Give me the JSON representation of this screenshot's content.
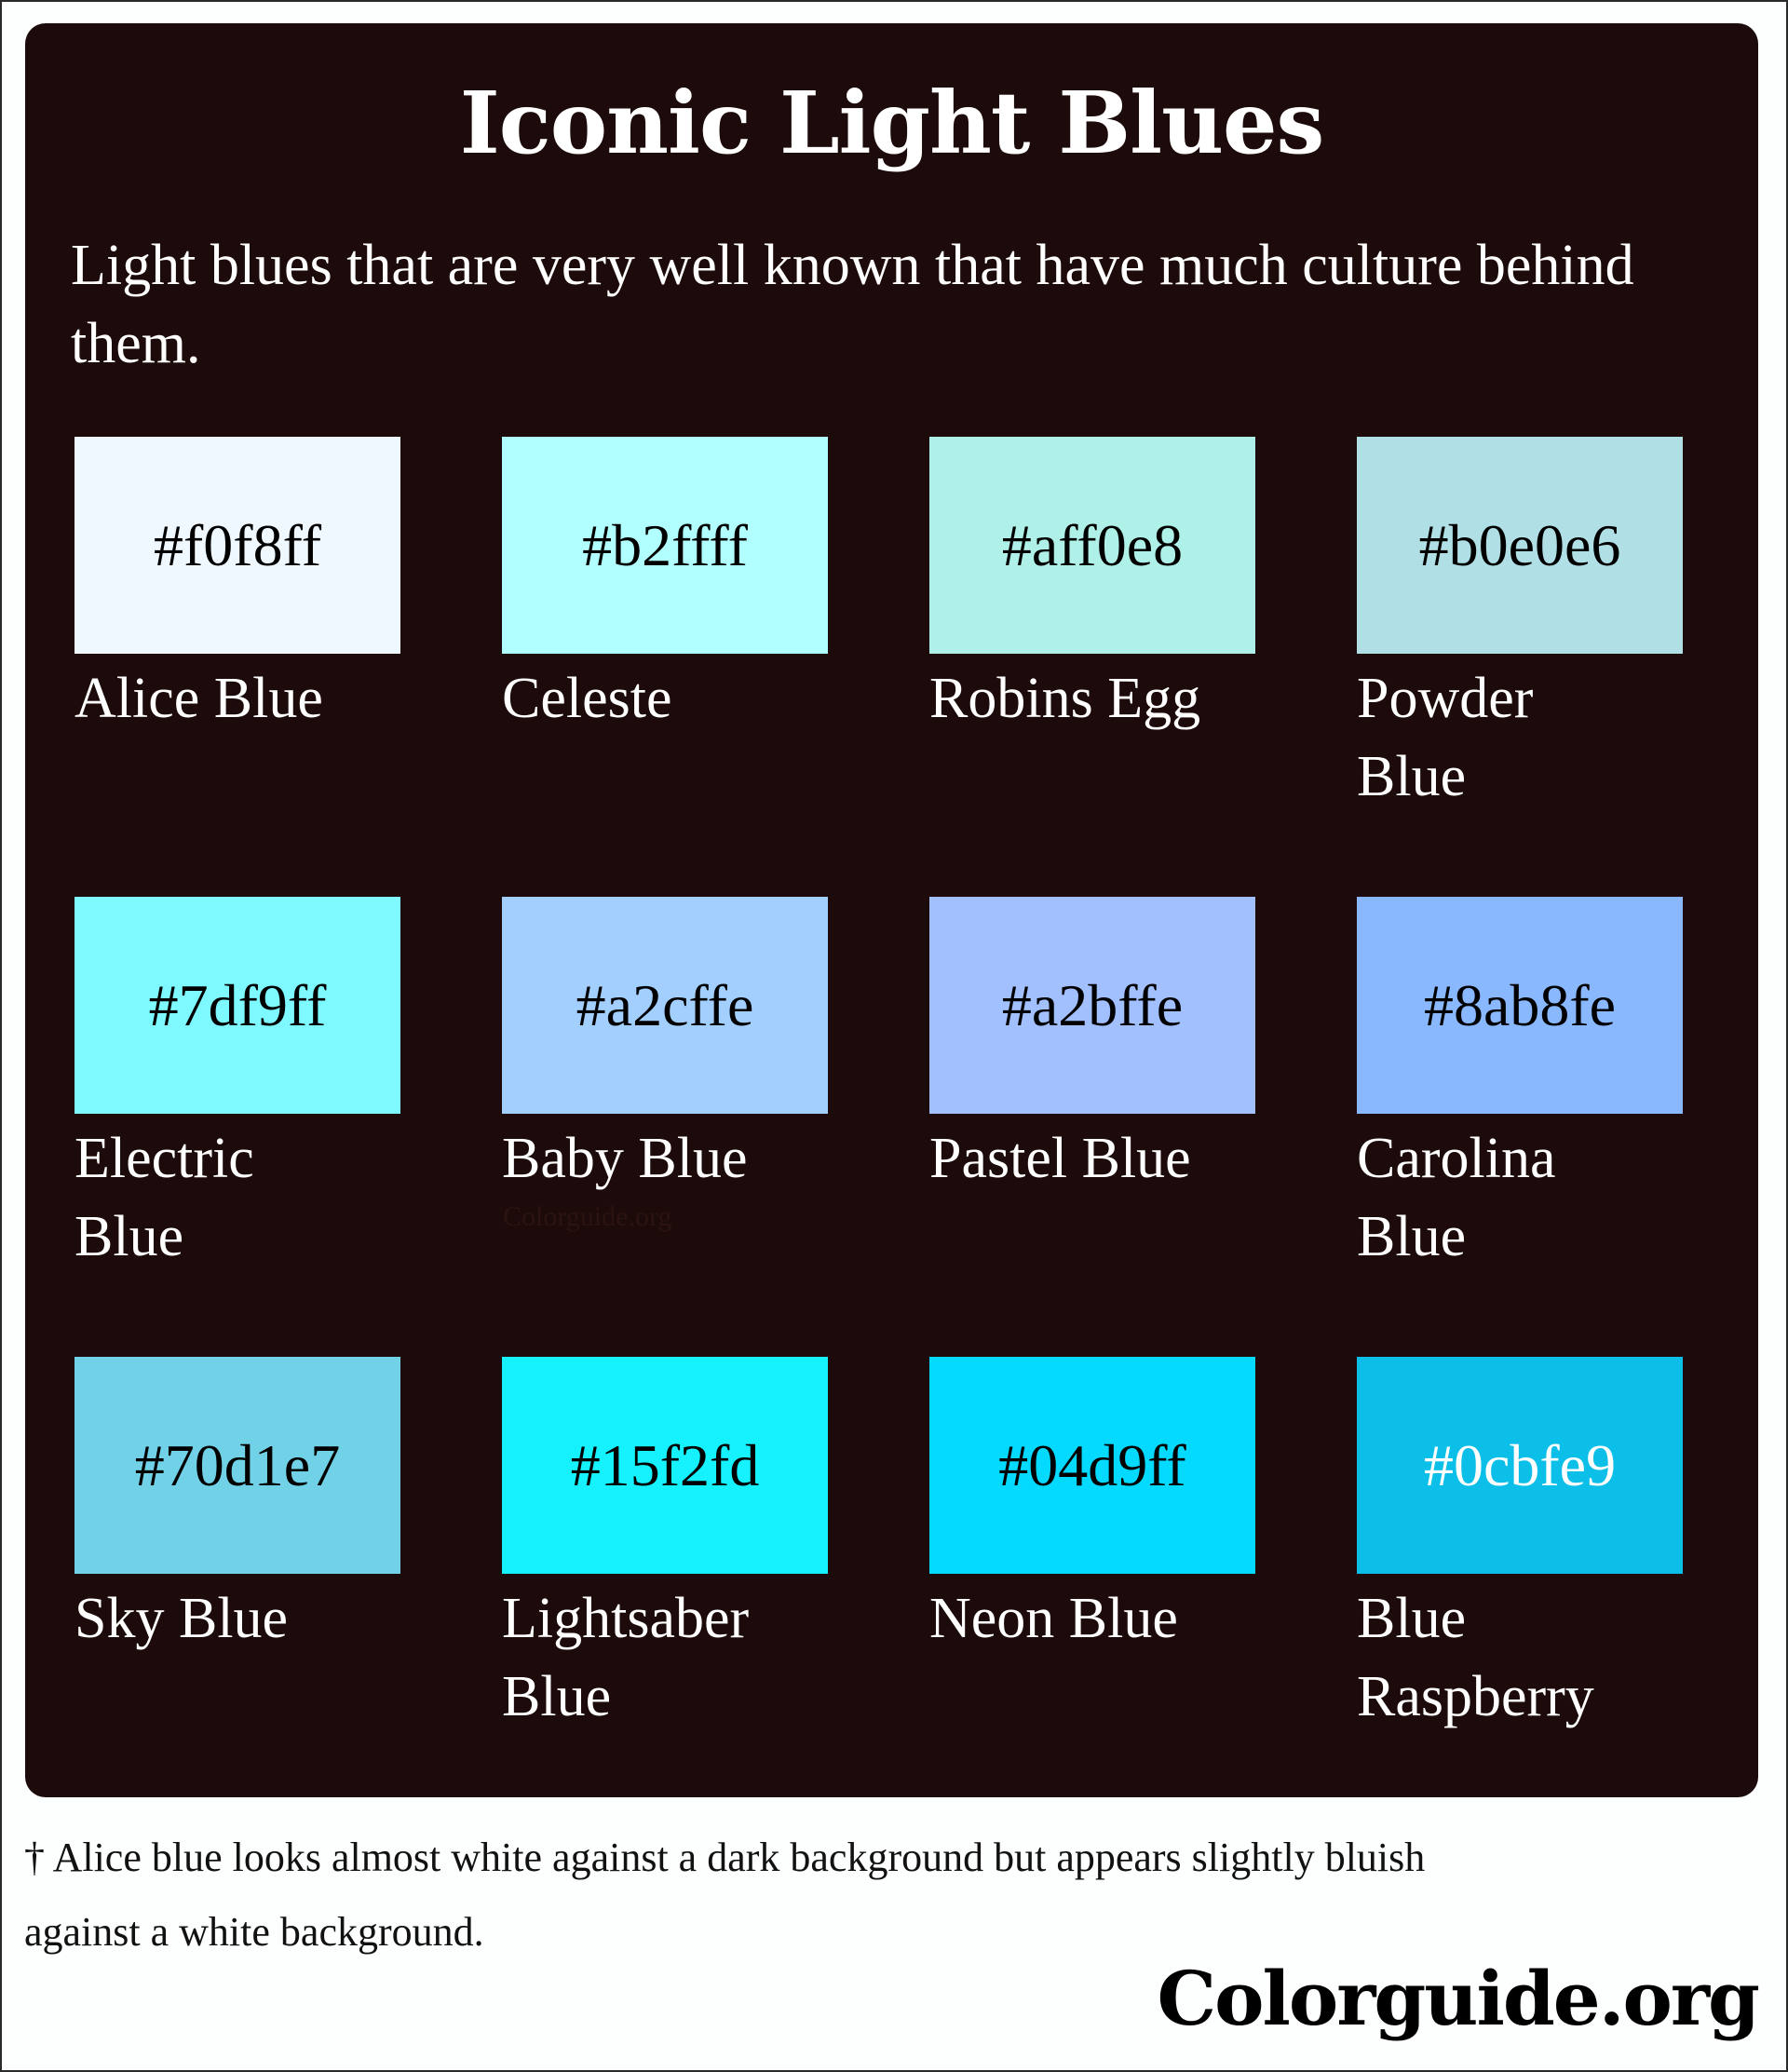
{
  "title": "Iconic Light Blues",
  "subtitle": "Light blues that are very well known that have much culture behind them.",
  "swatches": [
    {
      "hex": "#f0f8ff",
      "name": "Alice Blue",
      "text_color": "#000000"
    },
    {
      "hex": "#b2ffff",
      "name": "Celeste",
      "text_color": "#000000"
    },
    {
      "hex": "#aff0e8",
      "name": "Robins Egg",
      "text_color": "#000000"
    },
    {
      "hex": "#b0e0e6",
      "name": "Powder Blue",
      "text_color": "#000000"
    },
    {
      "hex": "#7df9ff",
      "name": "Electric Blue",
      "text_color": "#000000"
    },
    {
      "hex": "#a2cffe",
      "name": "Baby Blue",
      "text_color": "#000000"
    },
    {
      "hex": "#a2bffe",
      "name": "Pastel Blue",
      "text_color": "#000000"
    },
    {
      "hex": "#8ab8fe",
      "name": "Carolina Blue",
      "text_color": "#000000"
    },
    {
      "hex": "#70d1e7",
      "name": "Sky Blue",
      "text_color": "#000000"
    },
    {
      "hex": "#15f2fd",
      "name": "Lightsaber Blue",
      "text_color": "#000000"
    },
    {
      "hex": "#04d9ff",
      "name": "Neon Blue",
      "text_color": "#000000"
    },
    {
      "hex": "#0cbfe9",
      "name": "Blue Raspberry",
      "text_color": "#ffffff"
    }
  ],
  "watermark": "Colorguide.org",
  "footnote": "† Alice blue looks almost white against a dark background but appears slightly bluish against a white background.",
  "logo": "Colorguide.org",
  "colors": {
    "panel_background": "#1c0b0a",
    "page_background": "#ffffff"
  }
}
